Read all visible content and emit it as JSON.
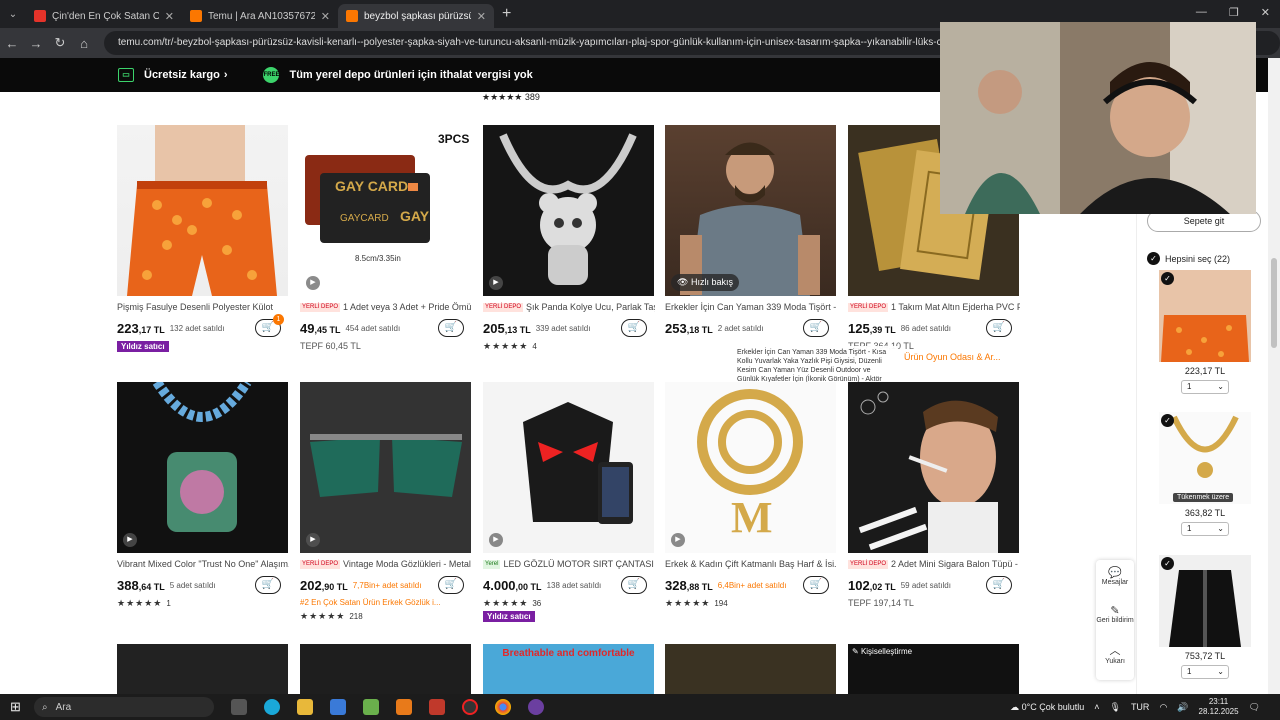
{
  "browser": {
    "tabs": [
      {
        "title": "Çin'den En Çok Satan Oyuncu...",
        "fav_color": "#e5332a",
        "active": false
      },
      {
        "title": "Temu | Ara AN10357672",
        "fav_color": "#fb7701",
        "active": false
      },
      {
        "title": "beyzbol şapkası pürüzsüz kavis...",
        "fav_color": "#fb7701",
        "active": true
      }
    ],
    "url": "temu.com/tr/-beyzbol-şapkası-pürüzsüz-kavisli-kenarlı--polyester-şapka-siyah-ve-turuncu-aksanlı-müzik-yapımcıları-plaj-spor-günlük-kullanım-için-unisex-tasarım-şapka--yıkanabilir-lüks-casual-kap"
  },
  "banner": {
    "shipping": "Ücretsiz kargo",
    "free_icon": "FREE",
    "tax": "Tüm yerel depo ürünleri için ithalat vergisi yok"
  },
  "prev_row_rating": "389",
  "products_row1": [
    {
      "title": "Pişmiş Fasulye Desenli Polyester Külot",
      "tag": "",
      "price_main": "223",
      "price_dec": ",17 TL",
      "sold": "132 adet satıldı",
      "sub": "",
      "badge": "Yıldız satıcı",
      "cart_count": "1",
      "stars": "",
      "rating": ""
    },
    {
      "title": "1 Adet veya 3 Adet + Pride Ömürl...",
      "tag": "YERLİ DEPO",
      "price_main": "49",
      "price_dec": ",45 TL",
      "sold": "454 adet satıldı",
      "sub": "TEPF 60,45 TL",
      "badge": "",
      "cart_count": "",
      "stars": "",
      "rating": ""
    },
    {
      "title": "Şık Panda Kolye Ucu, Parlak Taşlarl...",
      "tag": "YERLİ DEPO",
      "price_main": "205",
      "price_dec": ",13 TL",
      "sold": "339 adet satıldı",
      "sub": "",
      "badge": "",
      "cart_count": "",
      "stars": "★★★★★",
      "rating": "4"
    },
    {
      "title": "Erkekler İçin Can Yaman 339 Moda Tişört - ...",
      "tag": "",
      "price_main": "253",
      "price_dec": ",18 TL",
      "sold": "2 adet satıldı",
      "sub": "",
      "badge": "",
      "cart_count": "",
      "stars": "",
      "rating": ""
    },
    {
      "title": "1 Takım Mat Altın Ejderha PVC Plak...",
      "tag": "YERLİ DEPO",
      "price_main": "125",
      "price_dec": ",39 TL",
      "sold": "86 adet satıldı",
      "sub": "TEPF 364,10 TL",
      "badge": "",
      "cart_count": "",
      "stars": "",
      "rating": ""
    }
  ],
  "products_row2": [
    {
      "title": "Vibrant Mixed Color \"Trust No One\" Alaşım...",
      "tag": "",
      "price_main": "388",
      "price_dec": ",64 TL",
      "sold": "5 adet satıldı",
      "sub": "",
      "badge": "",
      "stars": "★★★★★",
      "rating": "1"
    },
    {
      "title": "Vintage Moda Gözlükleri - Metal Ç...",
      "tag": "YERLİ DEPO",
      "price_main": "202",
      "price_dec": ",90 TL",
      "sold": "7,7Bin+ adet satıldı",
      "sub": "#2 En Çok Satan Ürün Erkek Gözlük i...",
      "badge": "",
      "stars": "★★★★★",
      "rating": "218"
    },
    {
      "title": "LED GÖZLÜ MOTOR SIRT ÇANTASI ...",
      "tag": "Yerel",
      "price_main": "4.000",
      "price_dec": ",00 TL",
      "sold": "138 adet satıldı",
      "sub": "",
      "badge": "Yıldız satıcı",
      "stars": "★★★★★",
      "rating": "36"
    },
    {
      "title": "Erkek & Kadın Çift Katmanlı Baş Harf & İsi...",
      "tag": "",
      "price_main": "328",
      "price_dec": ",88 TL",
      "sold": "6,4Bin+ adet satıldı",
      "sub": "",
      "badge": "",
      "stars": "★★★★★",
      "rating": "194"
    },
    {
      "title": "2 Adet Mini Sigara Balon Tüpü - G...",
      "tag": "YERLİ DEPO",
      "price_main": "102",
      "price_dec": ",02 TL",
      "sold": "59 adet satıldı",
      "sub": "TEPF 197,14 TL",
      "badge": "",
      "stars": "",
      "rating": ""
    }
  ],
  "quick_view": "Hızlı bakış",
  "tooltip": "Erkekler İçin Can Yaman 339 Moda Tişört - Kısa Kollu Yuvarlak Yaka Yazlık Pişi Giysisi, Düzenli Kesim Can Yaman Yüz Desenli Outdoor ve Günlük Kıyafetler İçin (İkonik Görünüm) - Aktör Hayranları İçin A-Line Stil",
  "extra_text": "Ürün Oyun Odası & Ar...",
  "row3_label": "Kişiselleştirme",
  "row3_text": "Breathable and comfortable",
  "float_bar": {
    "messages": "Mesajlar",
    "feedback": "Geri bildirim",
    "top": "Yukarı"
  },
  "sidebar": {
    "cart_button": "Sepete git",
    "select_all": "Hepsini seç (22)",
    "items": [
      {
        "price": "223,17 TL",
        "qty": "1",
        "oos": ""
      },
      {
        "price": "363,82 TL",
        "qty": "1",
        "oos": "Tükenmek üzere"
      },
      {
        "price": "753,72 TL",
        "qty": "1",
        "oos": ""
      }
    ]
  },
  "taskbar": {
    "search": "Ara",
    "weather": "0°C  Çok bulutlu",
    "lang": "TUR",
    "time": "23:11",
    "date": "28.12.2025"
  }
}
